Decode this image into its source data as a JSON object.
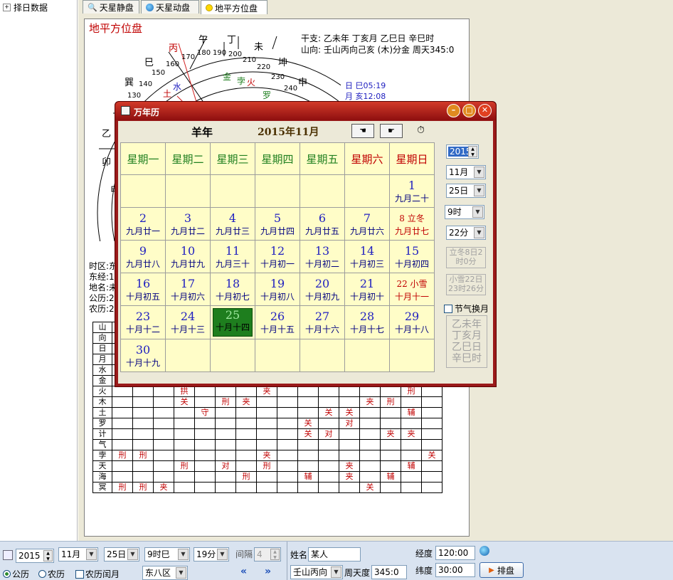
{
  "left_panel": {
    "tree_item": "择日数据"
  },
  "tabs": [
    {
      "label": "天星静盘",
      "icon": "magnifier-icon"
    },
    {
      "label": "天星动盘",
      "icon": "globe-icon"
    },
    {
      "label": "地平方位盘",
      "icon": "dot-icon"
    }
  ],
  "chart": {
    "title": "地平方位盘",
    "ganzhi_line": "干支: 乙未年 丁亥月 乙巳日 辛巳时",
    "shanxiang_line": "山向: 壬山丙向己亥 (木)分金  周天345:0",
    "sun_line": "日  巳05:19",
    "moon_line": "月  亥12:08",
    "ring_branches": [
      "午",
      "丁",
      "未",
      "坤",
      "申",
      "巳",
      "巽",
      "丙",
      "乙",
      "卯",
      "甲"
    ],
    "ring_degrees": [
      "170",
      "180",
      "190",
      "200",
      "210",
      "220",
      "230",
      "240",
      "160",
      "150",
      "140",
      "130"
    ],
    "ring_planets": [
      "金",
      "孛",
      "火",
      "水",
      "罗",
      "土"
    ],
    "info_labels": [
      "时区:东",
      "东经:1",
      "地名:未",
      "公历:2",
      "农历:2"
    ]
  },
  "grid": {
    "rows": [
      {
        "label": "山",
        "cells": [
          "",
          "",
          "",
          "",
          "",
          "",
          "",
          "",
          "",
          "",
          "",
          "",
          "",
          "",
          "",
          ""
        ]
      },
      {
        "label": "向",
        "cells": [
          "",
          "",
          "",
          "",
          "",
          "",
          "",
          "",
          "",
          "",
          "",
          "",
          "",
          "",
          "",
          ""
        ]
      },
      {
        "label": "日",
        "cells": [
          "",
          "",
          "",
          "",
          "",
          "",
          "",
          "",
          "",
          "",
          "",
          "",
          "",
          "",
          "",
          ""
        ]
      },
      {
        "label": "月",
        "cells": [
          "",
          "",
          "",
          "",
          "",
          "",
          "",
          "",
          "",
          "",
          "",
          "",
          "",
          "",
          "",
          ""
        ]
      },
      {
        "label": "水",
        "cells": [
          "",
          "",
          "",
          "",
          "",
          "",
          "",
          "",
          "",
          "",
          "",
          "",
          "",
          "",
          "",
          ""
        ]
      },
      {
        "label": "金",
        "cells": [
          "",
          "夹",
          "",
          "刑",
          "",
          "",
          "",
          "刑",
          "",
          "",
          "",
          "",
          "",
          "对",
          "",
          ""
        ]
      },
      {
        "label": "火",
        "cells": [
          "",
          "",
          "",
          "拱",
          "",
          "",
          "",
          "夹",
          "",
          "",
          "",
          "",
          "",
          "",
          "刑",
          ""
        ]
      },
      {
        "label": "木",
        "cells": [
          "",
          "",
          "",
          "关",
          "",
          "刑",
          "夹",
          "",
          "",
          "",
          "",
          "",
          "夹",
          "刑",
          "",
          ""
        ]
      },
      {
        "label": "土",
        "cells": [
          "",
          "",
          "",
          "",
          "守",
          "",
          "",
          "",
          "",
          "",
          "关",
          "关",
          "",
          "",
          "辅",
          ""
        ]
      },
      {
        "label": "罗",
        "cells": [
          "",
          "",
          "",
          "",
          "",
          "",
          "",
          "",
          "",
          "关",
          "",
          "对",
          "",
          "",
          "",
          ""
        ]
      },
      {
        "label": "计",
        "cells": [
          "",
          "",
          "",
          "",
          "",
          "",
          "",
          "",
          "",
          "关",
          "对",
          "",
          "",
          "夹",
          "夹",
          ""
        ]
      },
      {
        "label": "气",
        "cells": [
          "",
          "",
          "",
          "",
          "",
          "",
          "",
          "",
          "",
          "",
          "",
          "",
          "",
          "",
          "",
          ""
        ]
      },
      {
        "label": "孛",
        "cells": [
          "刑",
          "刑",
          "",
          "",
          "",
          "",
          "",
          "夹",
          "",
          "",
          "",
          "",
          "",
          "",
          "",
          "关"
        ]
      },
      {
        "label": "天",
        "cells": [
          "",
          "",
          "",
          "刑",
          "",
          "对",
          "",
          "刑",
          "",
          "",
          "",
          "夹",
          "",
          "",
          "辅",
          ""
        ]
      },
      {
        "label": "海",
        "cells": [
          "",
          "",
          "",
          "",
          "",
          "",
          "刑",
          "",
          "",
          "辅",
          "",
          "夹",
          "",
          "辅",
          "",
          ""
        ]
      },
      {
        "label": "冥",
        "cells": [
          "刑",
          "刑",
          "夹",
          "",
          "",
          "",
          "",
          "",
          "",
          "",
          "",
          "",
          "关",
          "",
          "",
          ""
        ]
      }
    ]
  },
  "calendar_dialog": {
    "title": "万年历",
    "year_name": "羊年",
    "month_label": "2015年11月",
    "weekdays": [
      "星期一",
      "星期二",
      "星期三",
      "星期四",
      "星期五",
      "星期六",
      "星期日"
    ],
    "weeks": [
      [
        {
          "d": "",
          "l": ""
        },
        {
          "d": "",
          "l": ""
        },
        {
          "d": "",
          "l": ""
        },
        {
          "d": "",
          "l": ""
        },
        {
          "d": "",
          "l": ""
        },
        {
          "d": "",
          "l": ""
        },
        {
          "d": "1",
          "l": "九月二十"
        }
      ],
      [
        {
          "d": "2",
          "l": "九月廿一"
        },
        {
          "d": "3",
          "l": "九月廿二"
        },
        {
          "d": "4",
          "l": "九月廿三"
        },
        {
          "d": "5",
          "l": "九月廿四"
        },
        {
          "d": "6",
          "l": "九月廿五"
        },
        {
          "d": "7",
          "l": "九月廿六"
        },
        {
          "d": "8  立冬",
          "l": "九月廿七",
          "red": true
        }
      ],
      [
        {
          "d": "9",
          "l": "九月廿八"
        },
        {
          "d": "10",
          "l": "九月廿九"
        },
        {
          "d": "11",
          "l": "九月三十"
        },
        {
          "d": "12",
          "l": "十月初一"
        },
        {
          "d": "13",
          "l": "十月初二"
        },
        {
          "d": "14",
          "l": "十月初三"
        },
        {
          "d": "15",
          "l": "十月初四"
        }
      ],
      [
        {
          "d": "16",
          "l": "十月初五"
        },
        {
          "d": "17",
          "l": "十月初六"
        },
        {
          "d": "18",
          "l": "十月初七"
        },
        {
          "d": "19",
          "l": "十月初八"
        },
        {
          "d": "20",
          "l": "十月初九"
        },
        {
          "d": "21",
          "l": "十月初十"
        },
        {
          "d": "22  小雪",
          "l": "十月十一",
          "red": true
        }
      ],
      [
        {
          "d": "23",
          "l": "十月十二"
        },
        {
          "d": "24",
          "l": "十月十三"
        },
        {
          "d": "25",
          "l": "十月十四",
          "selected": true
        },
        {
          "d": "26",
          "l": "十月十五"
        },
        {
          "d": "27",
          "l": "十月十六"
        },
        {
          "d": "28",
          "l": "十月十七"
        },
        {
          "d": "29",
          "l": "十月十八"
        }
      ],
      [
        {
          "d": "30",
          "l": "十月十九"
        },
        {
          "d": "",
          "l": ""
        },
        {
          "d": "",
          "l": ""
        },
        {
          "d": "",
          "l": ""
        },
        {
          "d": "",
          "l": ""
        },
        {
          "d": "",
          "l": ""
        },
        {
          "d": "",
          "l": ""
        }
      ]
    ],
    "side": {
      "year": "2015",
      "month": "11月",
      "day": "25日",
      "hour": "9时",
      "minute": "22分",
      "jieqi1": "立冬8日2时0分",
      "jieqi2": "小雪22日23时26分",
      "jieqi_checkbox": "节气换月",
      "ganzhi_box": [
        "乙未年",
        "丁亥月",
        "乙巳日",
        "辛巳时"
      ]
    }
  },
  "bottom": {
    "year": "2015",
    "month": "11月",
    "day": "25日",
    "hour": "9时巳",
    "minute": "19分",
    "interval_label": "间隔",
    "interval_value": "4",
    "radio_solar": "公历",
    "radio_lunar": "农历",
    "leap_checkbox": "农历闰月",
    "timezone": "东八区",
    "name_label": "姓名",
    "name_value": "某人",
    "shanxiang": "壬山丙向",
    "zhoutian_label": "周天度",
    "zhoutian_value": "345:0",
    "longitude_label": "经度",
    "longitude_value": "120:00",
    "latitude_label": "纬度",
    "latitude_value": "30:00",
    "arrange_button": "排盘"
  },
  "colors": {
    "dialog_red": "#9a1a1a",
    "calendar_bg": "#fffdc8",
    "selected_day": "#1e7e1e",
    "weekday_green": "#208020",
    "weekend_red": "#c00000"
  }
}
